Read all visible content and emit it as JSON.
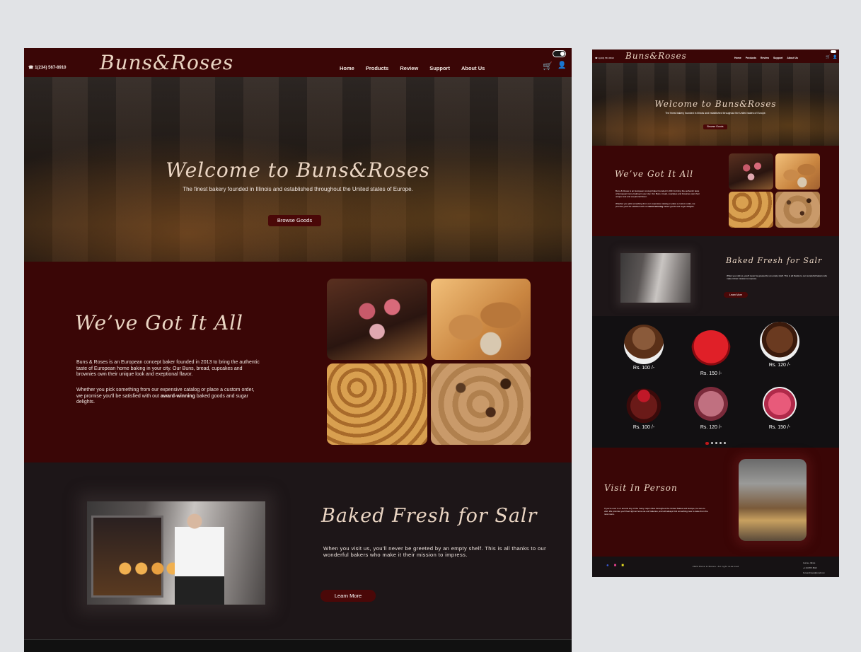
{
  "brand": {
    "logo": "Buns&Roses",
    "accent": "#3a0606",
    "button": "#4a0808",
    "heading_color": "#ead5c3"
  },
  "nav": {
    "phone": "☎ 1(234) 567-8910",
    "phone_small": "☎ 1(234) 567-8910",
    "items": [
      "Home",
      "Products",
      "Review",
      "Support",
      "About Us"
    ],
    "cart_icon": "🛒",
    "user_icon": "👤"
  },
  "hero": {
    "title": "Welcome to Buns&Roses",
    "subtitle": "The finest bakery founded in Illinois and established throughout the United states of Europe.",
    "button": "Browse Goods"
  },
  "about": {
    "title": "We’ve Got It All",
    "p1": "Buns & Roses is an European concept baker founded in 2013 to bring the authentic taste of European home baking in your city. Our Buns, bread, cupcakes and brownies own their unique look and exeptional flavor.",
    "p2_before": "Whether you pick something from our expensive catalog or place a custom order, we promise you'll be satisfied with out ",
    "p2_bold": "award-winning",
    "p2_after": " baked goods and sugar delights."
  },
  "fresh": {
    "title": "Baked Fresh for Salr",
    "text": "When you visit us, you'll never be greeted by an empty shelf. This is all thanks to our wonderful bakers who make it their mission to impress.",
    "button": "Learn More"
  },
  "products": [
    {
      "price": "Rs. 100 /-",
      "color": "#6b3a22"
    },
    {
      "price": "Rs. 150 /-",
      "color": "#c0141c"
    },
    {
      "price": "Rs. 120 /-",
      "color": "#4a2616"
    },
    {
      "price": "Rs. 100 /-",
      "color": "#5a1a18"
    },
    {
      "price": "Rs. 120 /-",
      "color": "#8a3a4a"
    },
    {
      "price": "Rs. 150 /-",
      "color": "#d84a6a"
    }
  ],
  "visit": {
    "title": "Visit In Person",
    "text": "If you're ever in or around any of the many major cities throughout the United States and Europe, be sure to visit. We promise you'll feel right at home as our bakeries, and will always find something new to taste from the new menu."
  },
  "footer": {
    "copyright": "2024 Buns & Roses. All right reserved",
    "contact": [
      "Gurnee, Illinois",
      "+1 234 567 8910",
      "bunsandroses@email.com"
    ],
    "social": [
      "facebook-icon",
      "instagram-icon",
      "snapchat-icon"
    ]
  }
}
